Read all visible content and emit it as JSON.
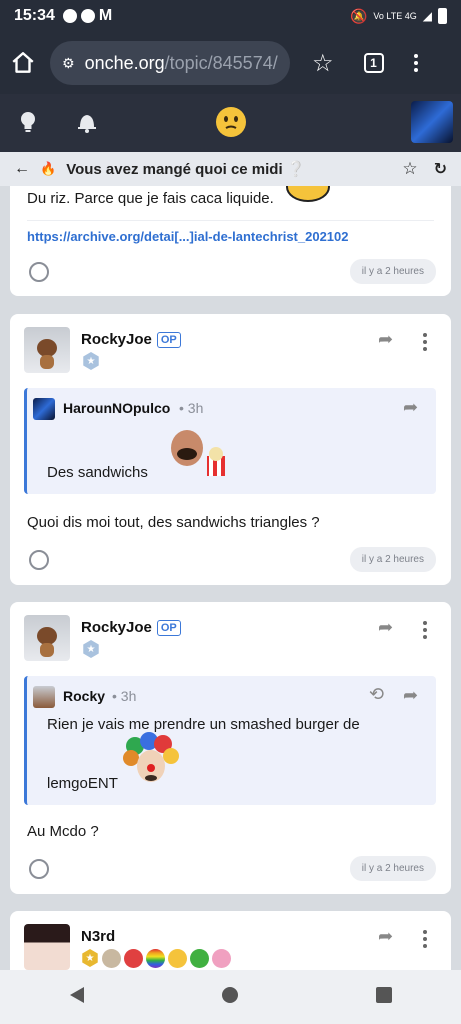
{
  "status_bar": {
    "time": "15:34",
    "network": "Vo LTE 4G"
  },
  "browser": {
    "url_host": "onche.org",
    "url_path": "/topic/845574/",
    "tab_count": "1"
  },
  "topic": {
    "title": "Vous avez mangé quoi ce midi ❔"
  },
  "post_partial": {
    "text": "Du riz. Parce que je fais caca liquide.",
    "link": "https://archive.org/detai[...]ial-de-lantechrist_202102",
    "time": "il y a 2 heures"
  },
  "post1": {
    "username": "RockyJoe",
    "badge": "OP",
    "quote": {
      "username": "HarounNOpulco",
      "time": "3h",
      "text": "Des sandwichs"
    },
    "text": "Quoi dis moi tout, des sandwichs triangles ?",
    "time": "il y a 2 heures"
  },
  "post2": {
    "username": "RockyJoe",
    "badge": "OP",
    "quote": {
      "username": "Rocky",
      "time": "3h",
      "text": "Rien je vais me prendre un smashed burger de",
      "text2": "lemgoENT"
    },
    "text": "Au Mcdo ?",
    "time": "il y a 2 heures"
  },
  "post3": {
    "username": "N3rd"
  }
}
